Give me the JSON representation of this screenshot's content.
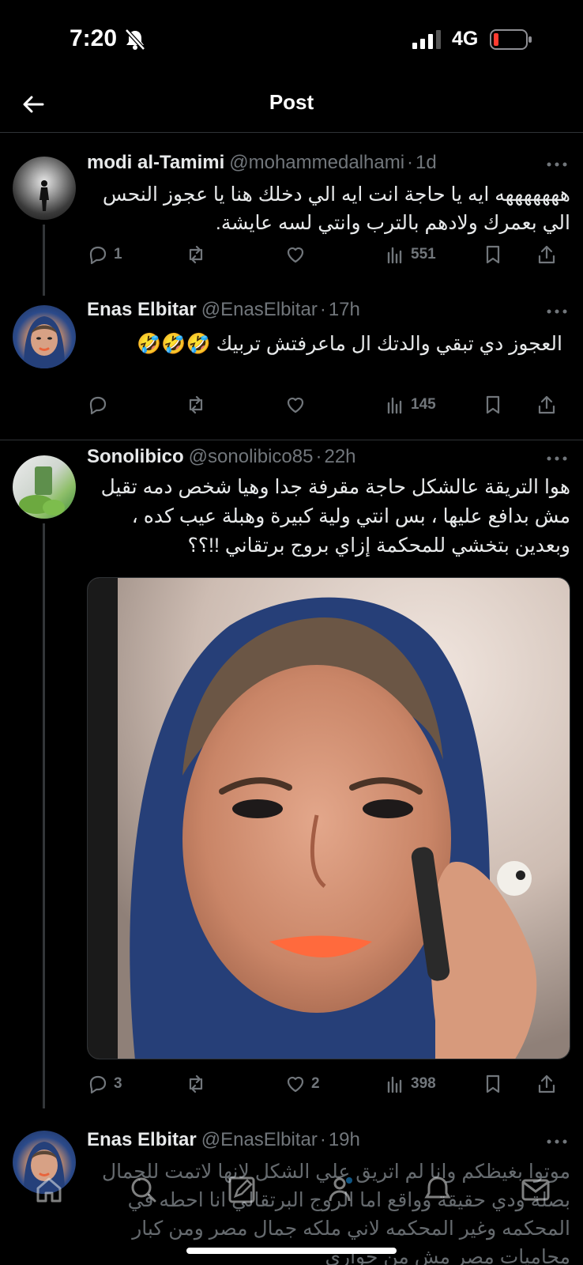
{
  "status_bar": {
    "time": "7:20",
    "network": "4G"
  },
  "header": {
    "title": "Post"
  },
  "posts": [
    {
      "name": "modi al-Tamimi",
      "handle": "@mohammedalhami",
      "time": "1d",
      "text": "هههههههه ايه يا حاجة انت ايه الي دخلك هنا يا عجوز النحس الي بعمرك ولادهم بالترب وانتي لسه عايشة.",
      "replies": "1",
      "reposts": "",
      "likes": "",
      "views": "551"
    },
    {
      "name": "Enas Elbitar",
      "handle": "@EnasElbitar",
      "time": "17h",
      "text": "العجوز دي تبقي والدتك ال ماعرفتش تربيك 🤣🤣🤣",
      "replies": "",
      "reposts": "",
      "likes": "",
      "views": "145"
    },
    {
      "name": "Sonolibico",
      "handle": "@sonolibico85",
      "time": "22h",
      "text": "هوا التريقة عالشكل حاجة مقرفة جدا وهيا شخص دمه تقيل مش بدافع عليها ، بس انتي ولية كبيرة وهبلة عيب كده ، وبعدين بتخشي للمحكمة إزاي بروج برتقاني !!؟؟",
      "replies": "3",
      "reposts": "",
      "likes": "2",
      "views": "398"
    },
    {
      "name": "Enas Elbitar",
      "handle": "@EnasElbitar",
      "time": "19h",
      "text": "موتوا بغيظكم وانا لم اتريق علي الشكل لانها لاتمت للجمال بصلة ودي حقيقة وواقع اما الروج البرتقالي انا احطه في المحكمه وغير المحكمه لاني ملكه جمال مصر ومن كبار محاميات مصر مش من حواري"
    }
  ],
  "colors": {
    "background": "#000000",
    "text": "#e7e9ea",
    "muted": "#71767b",
    "divider": "#2f3336",
    "battery_low": "#ff3b30"
  }
}
